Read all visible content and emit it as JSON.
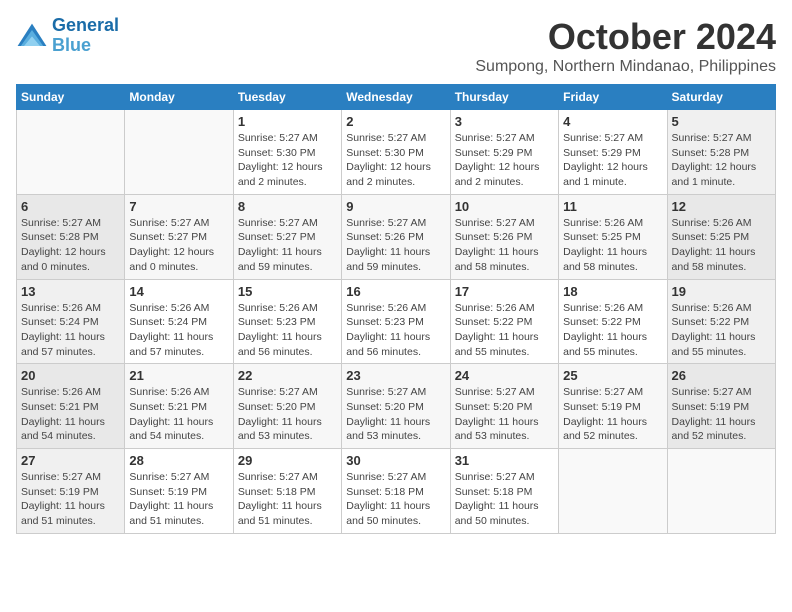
{
  "header": {
    "logo_line1": "General",
    "logo_line2": "Blue",
    "month": "October 2024",
    "location": "Sumpong, Northern Mindanao, Philippines"
  },
  "weekdays": [
    "Sunday",
    "Monday",
    "Tuesday",
    "Wednesday",
    "Thursday",
    "Friday",
    "Saturday"
  ],
  "weeks": [
    [
      {
        "day": "",
        "info": ""
      },
      {
        "day": "",
        "info": ""
      },
      {
        "day": "1",
        "info": "Sunrise: 5:27 AM\nSunset: 5:30 PM\nDaylight: 12 hours\nand 2 minutes."
      },
      {
        "day": "2",
        "info": "Sunrise: 5:27 AM\nSunset: 5:30 PM\nDaylight: 12 hours\nand 2 minutes."
      },
      {
        "day": "3",
        "info": "Sunrise: 5:27 AM\nSunset: 5:29 PM\nDaylight: 12 hours\nand 2 minutes."
      },
      {
        "day": "4",
        "info": "Sunrise: 5:27 AM\nSunset: 5:29 PM\nDaylight: 12 hours\nand 1 minute."
      },
      {
        "day": "5",
        "info": "Sunrise: 5:27 AM\nSunset: 5:28 PM\nDaylight: 12 hours\nand 1 minute."
      }
    ],
    [
      {
        "day": "6",
        "info": "Sunrise: 5:27 AM\nSunset: 5:28 PM\nDaylight: 12 hours\nand 0 minutes."
      },
      {
        "day": "7",
        "info": "Sunrise: 5:27 AM\nSunset: 5:27 PM\nDaylight: 12 hours\nand 0 minutes."
      },
      {
        "day": "8",
        "info": "Sunrise: 5:27 AM\nSunset: 5:27 PM\nDaylight: 11 hours\nand 59 minutes."
      },
      {
        "day": "9",
        "info": "Sunrise: 5:27 AM\nSunset: 5:26 PM\nDaylight: 11 hours\nand 59 minutes."
      },
      {
        "day": "10",
        "info": "Sunrise: 5:27 AM\nSunset: 5:26 PM\nDaylight: 11 hours\nand 58 minutes."
      },
      {
        "day": "11",
        "info": "Sunrise: 5:26 AM\nSunset: 5:25 PM\nDaylight: 11 hours\nand 58 minutes."
      },
      {
        "day": "12",
        "info": "Sunrise: 5:26 AM\nSunset: 5:25 PM\nDaylight: 11 hours\nand 58 minutes."
      }
    ],
    [
      {
        "day": "13",
        "info": "Sunrise: 5:26 AM\nSunset: 5:24 PM\nDaylight: 11 hours\nand 57 minutes."
      },
      {
        "day": "14",
        "info": "Sunrise: 5:26 AM\nSunset: 5:24 PM\nDaylight: 11 hours\nand 57 minutes."
      },
      {
        "day": "15",
        "info": "Sunrise: 5:26 AM\nSunset: 5:23 PM\nDaylight: 11 hours\nand 56 minutes."
      },
      {
        "day": "16",
        "info": "Sunrise: 5:26 AM\nSunset: 5:23 PM\nDaylight: 11 hours\nand 56 minutes."
      },
      {
        "day": "17",
        "info": "Sunrise: 5:26 AM\nSunset: 5:22 PM\nDaylight: 11 hours\nand 55 minutes."
      },
      {
        "day": "18",
        "info": "Sunrise: 5:26 AM\nSunset: 5:22 PM\nDaylight: 11 hours\nand 55 minutes."
      },
      {
        "day": "19",
        "info": "Sunrise: 5:26 AM\nSunset: 5:22 PM\nDaylight: 11 hours\nand 55 minutes."
      }
    ],
    [
      {
        "day": "20",
        "info": "Sunrise: 5:26 AM\nSunset: 5:21 PM\nDaylight: 11 hours\nand 54 minutes."
      },
      {
        "day": "21",
        "info": "Sunrise: 5:26 AM\nSunset: 5:21 PM\nDaylight: 11 hours\nand 54 minutes."
      },
      {
        "day": "22",
        "info": "Sunrise: 5:27 AM\nSunset: 5:20 PM\nDaylight: 11 hours\nand 53 minutes."
      },
      {
        "day": "23",
        "info": "Sunrise: 5:27 AM\nSunset: 5:20 PM\nDaylight: 11 hours\nand 53 minutes."
      },
      {
        "day": "24",
        "info": "Sunrise: 5:27 AM\nSunset: 5:20 PM\nDaylight: 11 hours\nand 53 minutes."
      },
      {
        "day": "25",
        "info": "Sunrise: 5:27 AM\nSunset: 5:19 PM\nDaylight: 11 hours\nand 52 minutes."
      },
      {
        "day": "26",
        "info": "Sunrise: 5:27 AM\nSunset: 5:19 PM\nDaylight: 11 hours\nand 52 minutes."
      }
    ],
    [
      {
        "day": "27",
        "info": "Sunrise: 5:27 AM\nSunset: 5:19 PM\nDaylight: 11 hours\nand 51 minutes."
      },
      {
        "day": "28",
        "info": "Sunrise: 5:27 AM\nSunset: 5:19 PM\nDaylight: 11 hours\nand 51 minutes."
      },
      {
        "day": "29",
        "info": "Sunrise: 5:27 AM\nSunset: 5:18 PM\nDaylight: 11 hours\nand 51 minutes."
      },
      {
        "day": "30",
        "info": "Sunrise: 5:27 AM\nSunset: 5:18 PM\nDaylight: 11 hours\nand 50 minutes."
      },
      {
        "day": "31",
        "info": "Sunrise: 5:27 AM\nSunset: 5:18 PM\nDaylight: 11 hours\nand 50 minutes."
      },
      {
        "day": "",
        "info": ""
      },
      {
        "day": "",
        "info": ""
      }
    ]
  ]
}
